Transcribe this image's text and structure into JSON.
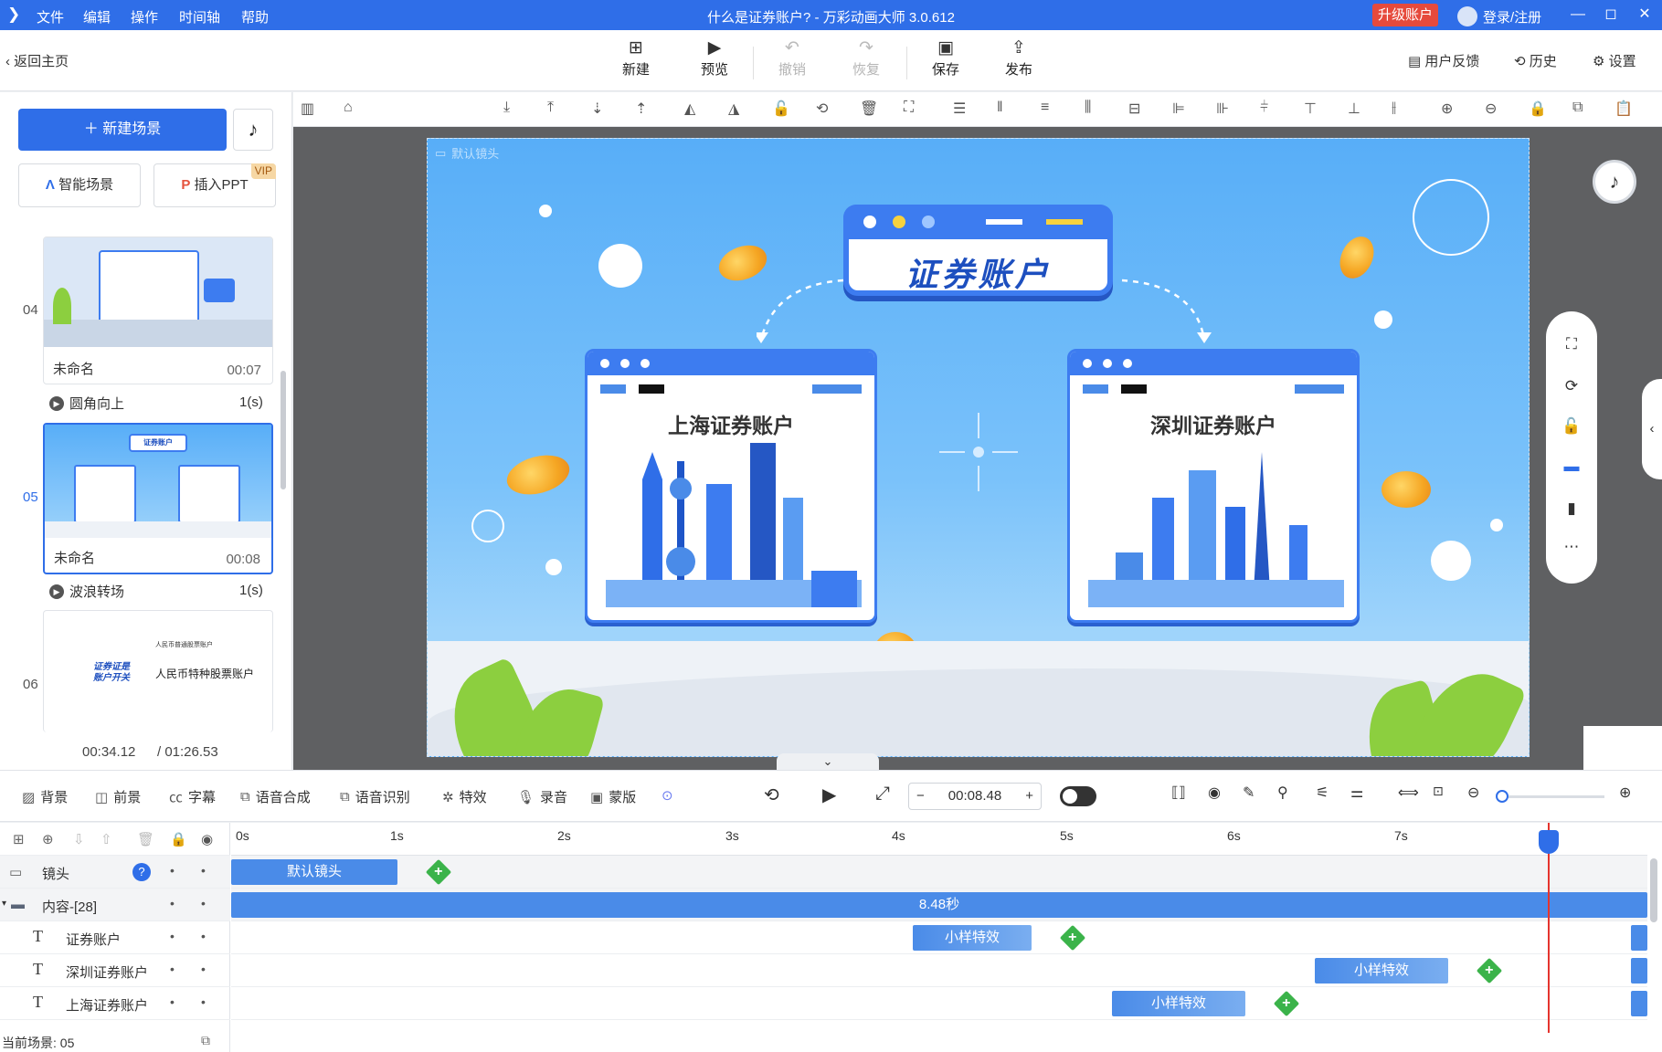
{
  "titlebar": {
    "menu": [
      "文件",
      "编辑",
      "操作",
      "时间轴",
      "帮助"
    ],
    "title": "什么是证券账户? - 万彩动画大师 3.0.612",
    "upgrade": "升级账户",
    "login": "登录/注册"
  },
  "toolbar": {
    "back": "返回主页",
    "buttons": [
      {
        "label": "新建",
        "icon": "new-icon",
        "enabled": true
      },
      {
        "label": "预览",
        "icon": "play-icon",
        "enabled": true
      },
      {
        "label": "撤销",
        "icon": "undo-icon",
        "enabled": false
      },
      {
        "label": "恢复",
        "icon": "redo-icon",
        "enabled": false
      },
      {
        "label": "保存",
        "icon": "save-icon",
        "enabled": true
      },
      {
        "label": "发布",
        "icon": "publish-icon",
        "enabled": true
      }
    ],
    "feedback": "用户反馈",
    "history": "历史",
    "settings": "设置"
  },
  "leftpanel": {
    "new_scene": "新建场景",
    "smart_scene": "智能场景",
    "insert_ppt": "插入PPT",
    "vip": "VIP",
    "scenes": [
      {
        "num": "04",
        "name": "未命名",
        "duration": "00:07",
        "transition": "圆角向上",
        "transition_dur": "1(s)",
        "selected": false
      },
      {
        "num": "05",
        "name": "未命名",
        "duration": "00:08",
        "transition": "波浪转场",
        "transition_dur": "1(s)",
        "selected": true
      },
      {
        "num": "06",
        "name": "",
        "duration": "",
        "transition": "",
        "transition_dur": "",
        "selected": false
      }
    ],
    "scene6_texts": [
      "证券证是账户开关",
      "人民币普通股票账户",
      "人民币特种股票账户"
    ],
    "current_time": "00:34.12",
    "total_time": "/ 01:26.53"
  },
  "stage": {
    "camera_label": "默认镜头",
    "title": "证券账户",
    "card_left": "上海证券账户",
    "card_right": "深圳证券账户"
  },
  "timeline_toolbar": {
    "tools": [
      "背景",
      "前景",
      "字幕",
      "语音合成",
      "语音识别",
      "特效",
      "录音",
      "蒙版"
    ],
    "time": "00:08.48",
    "minus": "−",
    "plus": "+"
  },
  "timeline": {
    "ticks": [
      "0s",
      "1s",
      "2s",
      "3s",
      "4s",
      "5s",
      "6s",
      "7s"
    ],
    "tracks": [
      {
        "name": "镜头",
        "type": "camera"
      },
      {
        "name": "内容-[28]",
        "type": "folder"
      },
      {
        "name": "证券账户",
        "type": "text"
      },
      {
        "name": "深圳证券账户",
        "type": "text"
      },
      {
        "name": "上海证券账户",
        "type": "text"
      }
    ],
    "clips": {
      "camera": "默认镜头",
      "content": "8.48秒",
      "fx1": "小样特效",
      "fx2": "小样特效",
      "fx3": "小样特效"
    },
    "status": "当前场景: 05"
  }
}
